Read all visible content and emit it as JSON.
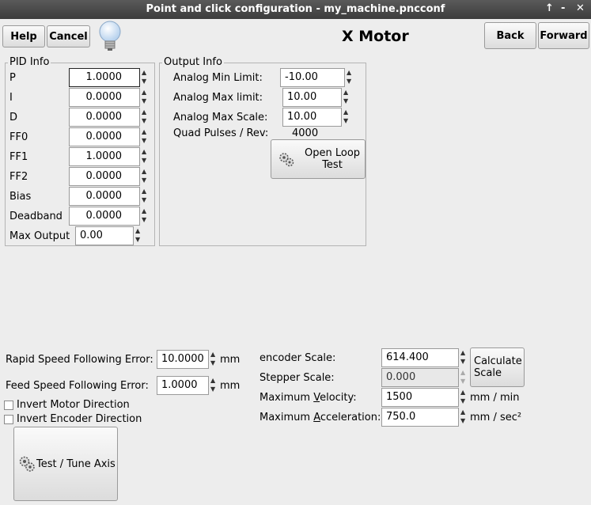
{
  "window": {
    "title": "Point and click configuration - my_machine.pncconf",
    "controls": {
      "maximize": "↑",
      "minimize": "‑",
      "close": "✕"
    }
  },
  "toolbar": {
    "help": "Help",
    "cancel": "Cancel",
    "back": "Back",
    "forward": "Forward"
  },
  "page_title": "X Motor",
  "pid": {
    "legend": "PID Info",
    "rows": [
      {
        "label": "P",
        "value": "1.0000"
      },
      {
        "label": "I",
        "value": "0.0000"
      },
      {
        "label": "D",
        "value": "0.0000"
      },
      {
        "label": "FF0",
        "value": "0.0000"
      },
      {
        "label": "FF1",
        "value": "1.0000"
      },
      {
        "label": "FF2",
        "value": "0.0000"
      },
      {
        "label": "Bias",
        "value": "0.0000"
      },
      {
        "label": "Deadband",
        "value": "0.0000"
      }
    ],
    "max_output_label": "Max Output",
    "max_output_value": "0.00"
  },
  "output": {
    "legend": "Output Info",
    "analog_min_label": "Analog Min Limit:",
    "analog_min_value": "-10.00",
    "analog_max_label": "Analog Max limit:",
    "analog_max_value": "10.00",
    "analog_scale_label": "Analog Max Scale:",
    "analog_scale_value": "10.00",
    "quad_label": "Quad Pulses / Rev:",
    "quad_value": "4000",
    "open_loop_line1": "Open Loop",
    "open_loop_line2": "Test"
  },
  "following": {
    "rapid_label": "Rapid Speed Following Error:",
    "rapid_value": "10.0000",
    "feed_label": "Feed Speed Following Error:",
    "feed_value": "1.0000",
    "unit": "mm"
  },
  "invert": {
    "motor": "Invert Motor Direction",
    "encoder": "Invert Encoder Direction"
  },
  "test_tune": "Test / Tune Axis",
  "scale": {
    "encoder_label": "encoder Scale:",
    "encoder_value": "614.400",
    "stepper_label": "Stepper Scale:",
    "stepper_value": "0.000",
    "velocity_label_pre": "Maximum ",
    "velocity_label_u": "V",
    "velocity_label_post": "elocity:",
    "velocity_value": "1500",
    "velocity_unit": "mm / min",
    "accel_label_pre": "Maximum ",
    "accel_label_u": "A",
    "accel_label_post": "cceleration:",
    "accel_value": "750.0",
    "accel_unit": "mm / sec²",
    "calc_line1": "Calculate",
    "calc_line2": "Scale"
  }
}
